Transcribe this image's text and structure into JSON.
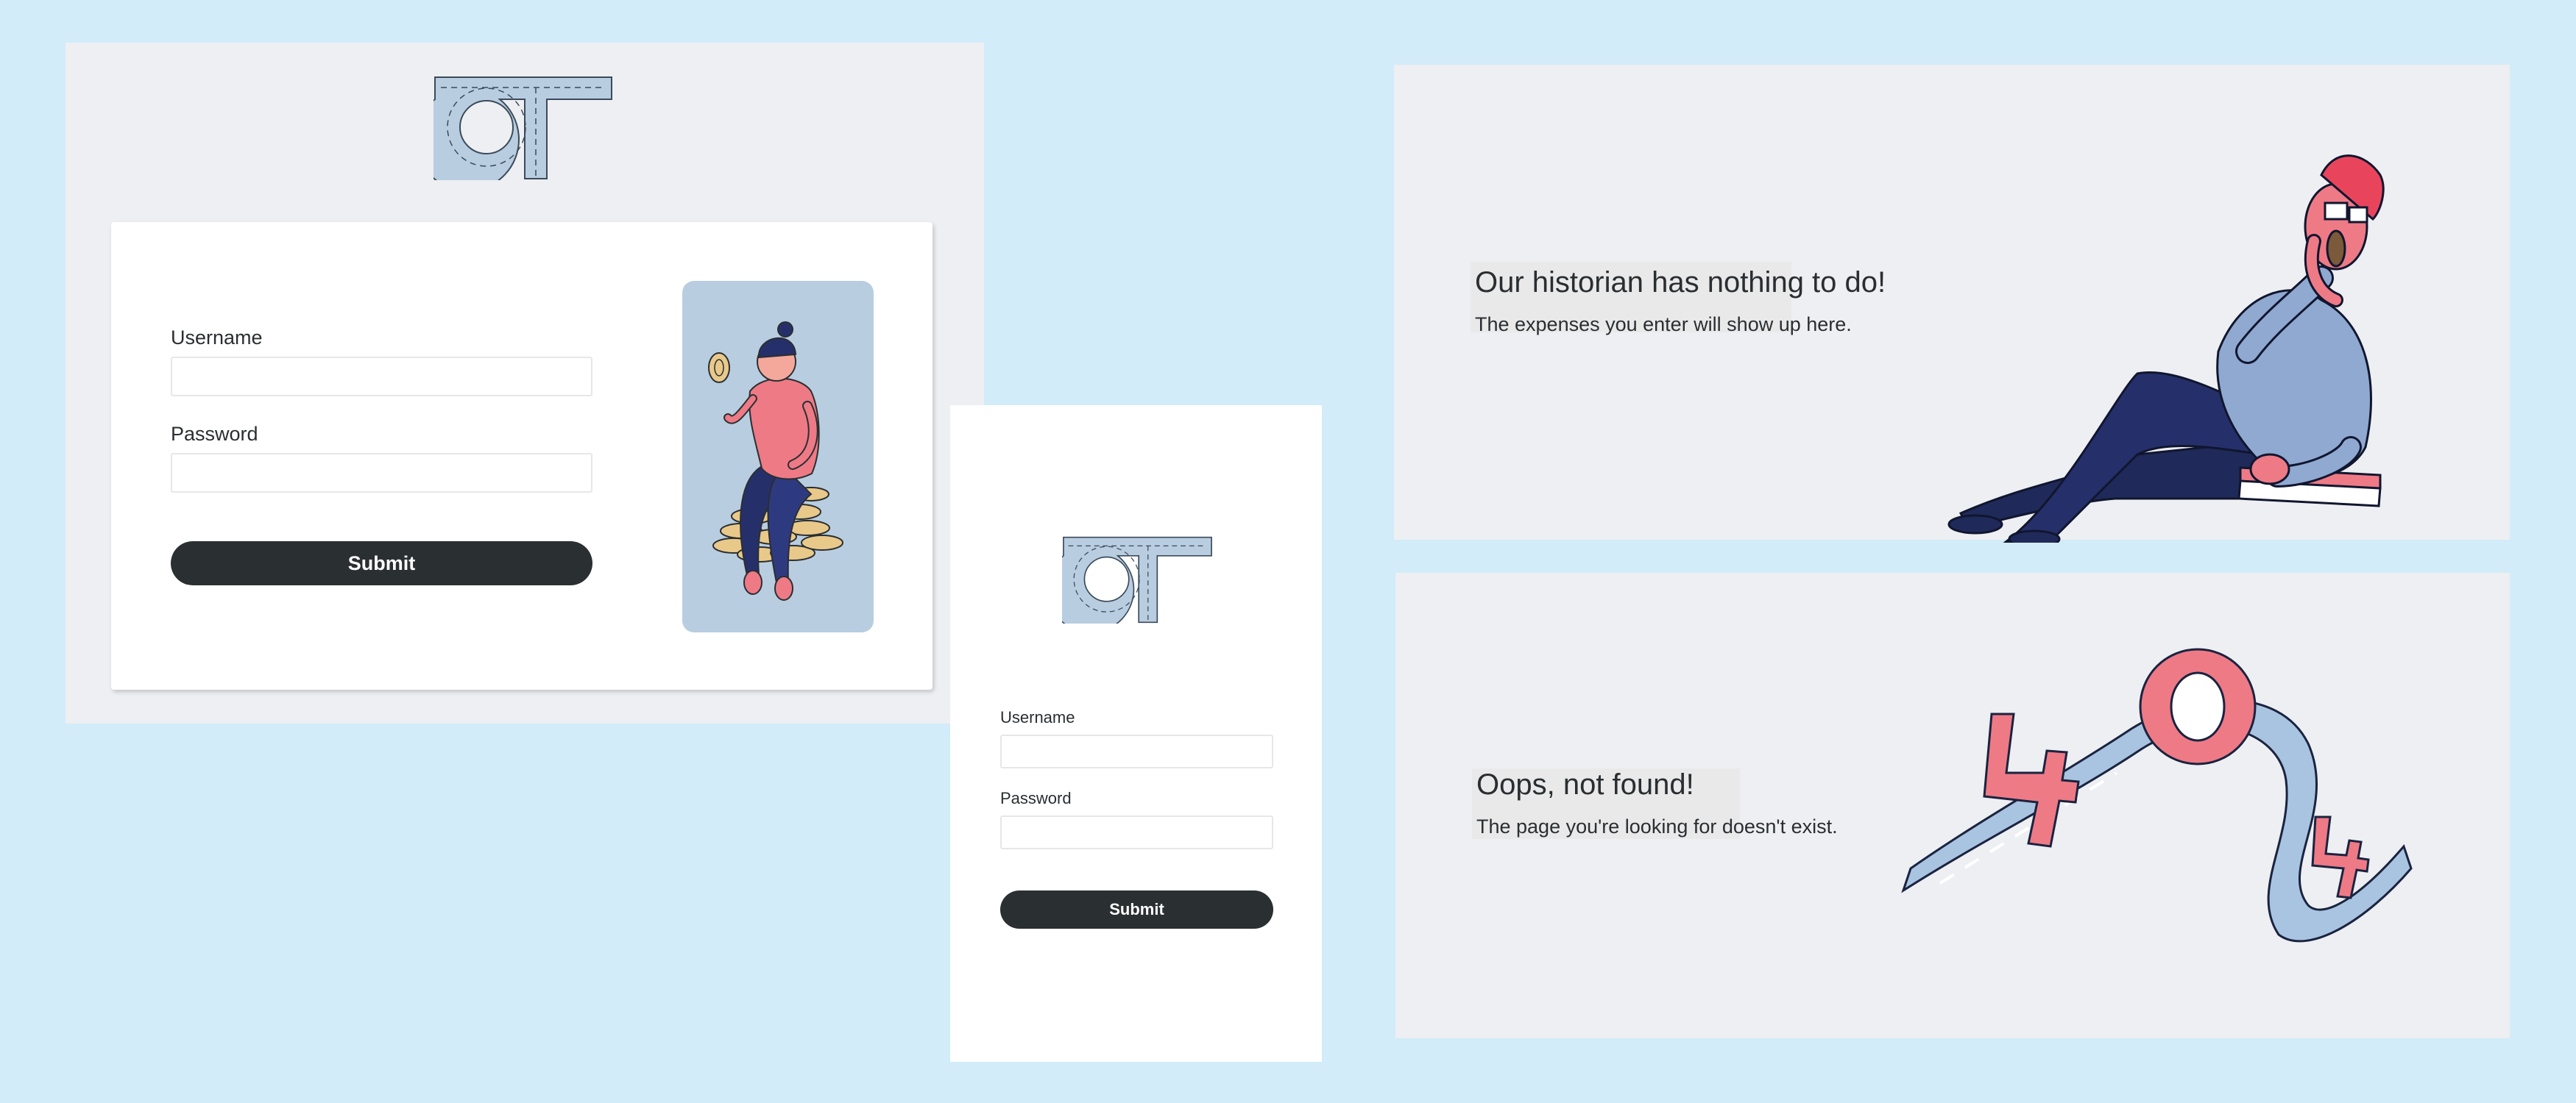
{
  "desktop_login": {
    "username_label": "Username",
    "password_label": "Password",
    "username_value": "",
    "password_value": "",
    "submit_label": "Submit"
  },
  "mobile_login": {
    "username_label": "Username",
    "password_label": "Password",
    "username_value": "",
    "password_value": "",
    "submit_label": "Submit"
  },
  "empty_state": {
    "title": "Our historian has nothing to do!",
    "subtitle": "The expenses you enter will show up here."
  },
  "not_found": {
    "title": "Oops, not found!",
    "subtitle": "The page you're looking for doesn't exist."
  },
  "colors": {
    "page_background": "#d2ecf9",
    "panel_background": "#eeeff2",
    "button_background": "#2a2f32",
    "logo_fill": "#b8cde0",
    "accent_pink": "#ee7a86",
    "navy": "#1f2a5a"
  },
  "icons": [
    "ot-logo",
    "man-on-coins-illustration",
    "historian-illustration",
    "404-illustration"
  ]
}
